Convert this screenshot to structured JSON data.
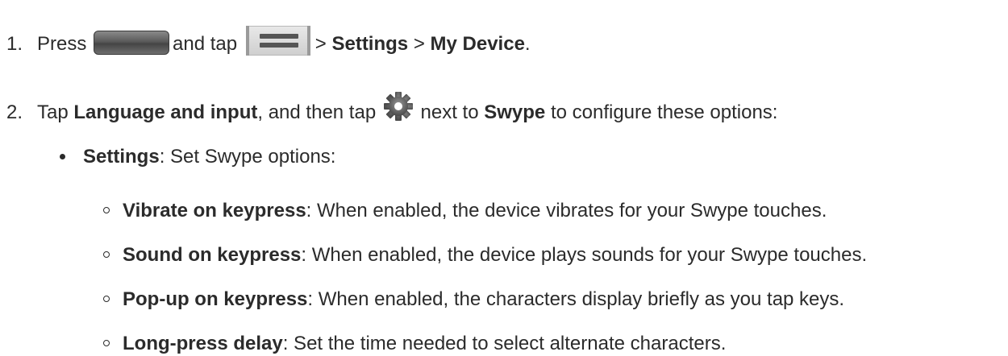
{
  "step1": {
    "number": "1.",
    "press_label": "Press",
    "tap_label": "and tap",
    "sep1": ">",
    "settings": "Settings",
    "sep2": ">",
    "my_device": "My Device",
    "end": "."
  },
  "step2": {
    "number": "2.",
    "tap_label": "Tap",
    "language_input": "Language and input",
    "then_tap": ", and then tap",
    "next_to": "next to",
    "swype": "Swype",
    "rest": "to configure these options:"
  },
  "settings_item": {
    "label": "Settings",
    "text": ": Set Swype options:"
  },
  "options": [
    {
      "label": "Vibrate on keypress",
      "text": ": When enabled, the device vibrates for your Swype touches."
    },
    {
      "label": "Sound on keypress",
      "text": ": When enabled, the device plays sounds for your Swype touches."
    },
    {
      "label": "Pop-up on keypress",
      "text": ": When enabled, the characters display briefly as you tap keys."
    },
    {
      "label": "Long-press delay",
      "text": ": Set the time needed to select alternate characters."
    }
  ],
  "icons": {
    "home": "home-button-icon",
    "menu": "menu-button-icon",
    "gear": "gear-icon"
  }
}
